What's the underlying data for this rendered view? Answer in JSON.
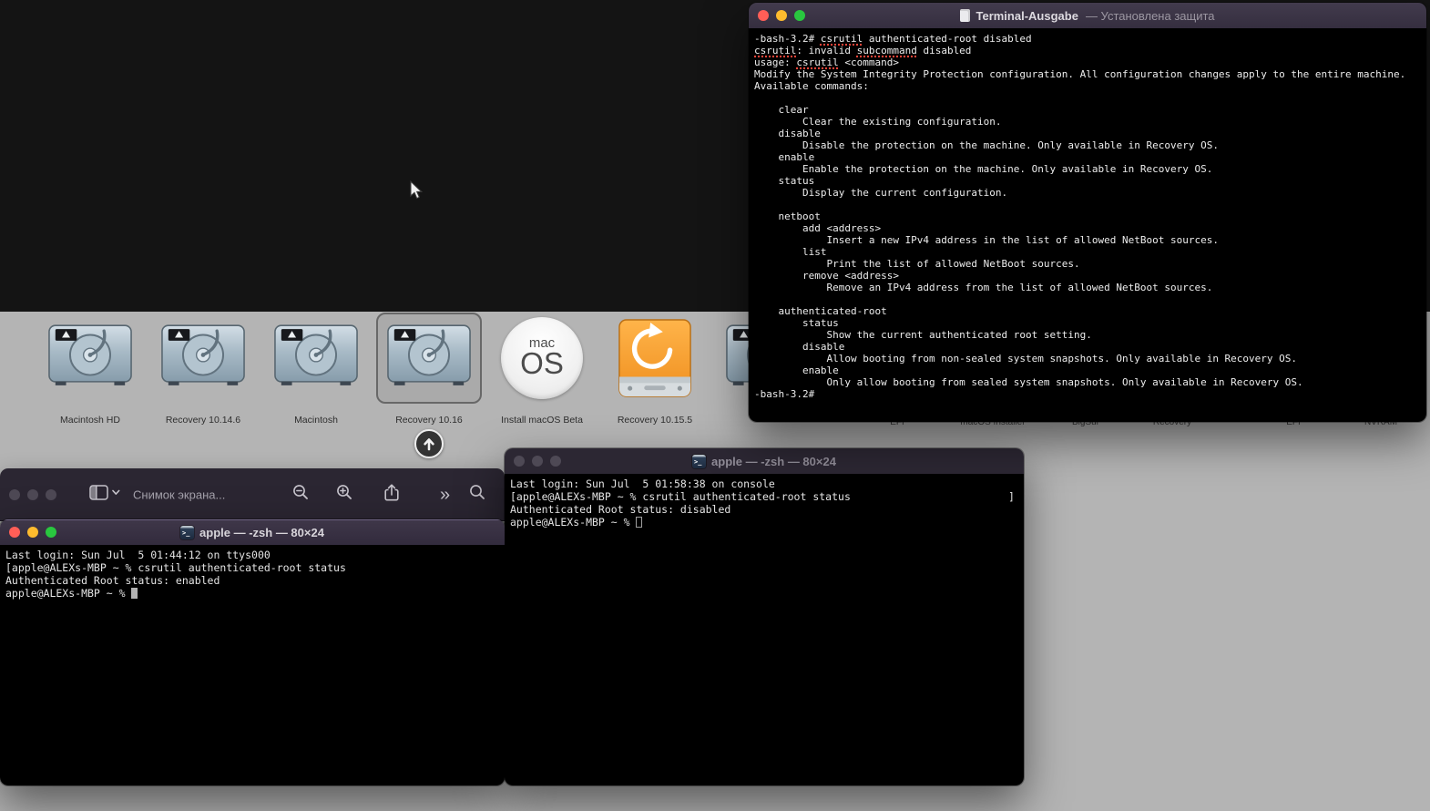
{
  "boot_picker": {
    "items": [
      {
        "label": "Macintosh HD",
        "type": "internal-drive"
      },
      {
        "label": "Recovery 10.14.6",
        "type": "internal-drive"
      },
      {
        "label": "Macintosh",
        "type": "internal-drive"
      },
      {
        "label": "Recovery 10.16",
        "type": "internal-drive",
        "selected": true
      },
      {
        "label": "Install macOS Beta",
        "type": "macos-installer"
      },
      {
        "label": "Recovery 10.15.5",
        "type": "external-drive-orange"
      },
      {
        "label": "",
        "type": "internal-drive"
      }
    ],
    "installer_badge": {
      "top": "mac",
      "bottom": "OS"
    },
    "hidden_labels": [
      "EFI",
      "macOS Installer",
      "BigSur",
      "Recovery",
      "EFI",
      "NVRAM"
    ]
  },
  "windows": {
    "ausgabe": {
      "title": "Terminal-Ausgabe",
      "title_suffix": "— Установлена защита",
      "content": "-bash-3.2# csrutil authenticated-root disabled\ncsrutil: invalid subcommand disabled\nusage: csrutil <command>\nModify the System Integrity Protection configuration. All configuration changes apply to the entire machine.\nAvailable commands:\n\n    clear\n        Clear the existing configuration.\n    disable\n        Disable the protection on the machine. Only available in Recovery OS.\n    enable\n        Enable the protection on the machine. Only available in Recovery OS.\n    status\n        Display the current configuration.\n\n    netboot\n        add <address>\n            Insert a new IPv4 address in the list of allowed NetBoot sources.\n        list\n            Print the list of allowed NetBoot sources.\n        remove <address>\n            Remove an IPv4 address from the list of allowed NetBoot sources.\n\n    authenticated-root\n        status\n            Show the current authenticated root setting.\n        disable\n            Allow booting from non-sealed system snapshots. Only available in Recovery OS.\n        enable\n            Only allow booting from sealed system snapshots. Only available in Recovery OS.\n-bash-3.2#"
    },
    "middle_terminal": {
      "title": "apple — -zsh — 80×24",
      "content": "Last login: Sun Jul  5 01:58:38 on console\n[apple@ALEXs-MBP ~ % csrutil authenticated-root status                         ]\nAuthenticated Root status: disabled\napple@ALEXs-MBP ~ % "
    },
    "bottom_terminal": {
      "title": "apple — -zsh — 80×24",
      "content": "Last login: Sun Jul  5 01:44:12 on ttys000\n[apple@ALEXs-MBP ~ % csrutil authenticated-root status\nAuthenticated Root status: enabled\napple@ALEXs-MBP ~ % "
    },
    "preview": {
      "title": "Снимок экрана...",
      "overflow_glyph": "»",
      "icons": [
        "sidebar",
        "zoom-out",
        "zoom-in",
        "share",
        "overflow",
        "search"
      ]
    }
  }
}
